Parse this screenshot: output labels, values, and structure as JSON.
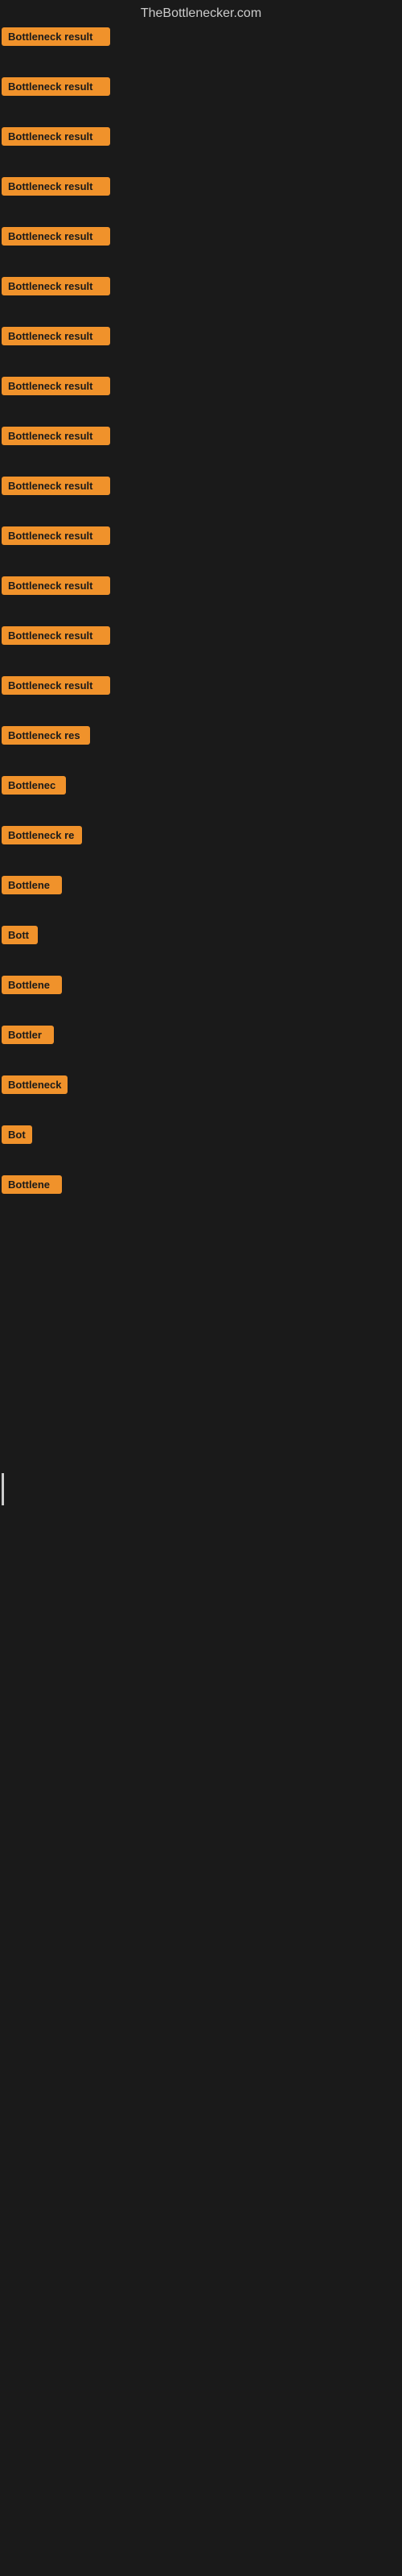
{
  "site": {
    "title": "TheBottlenecker.com"
  },
  "items": [
    {
      "id": 1,
      "label": "Bottleneck result",
      "width": 135
    },
    {
      "id": 2,
      "label": "Bottleneck result",
      "width": 135
    },
    {
      "id": 3,
      "label": "Bottleneck result",
      "width": 135
    },
    {
      "id": 4,
      "label": "Bottleneck result",
      "width": 135
    },
    {
      "id": 5,
      "label": "Bottleneck result",
      "width": 135
    },
    {
      "id": 6,
      "label": "Bottleneck result",
      "width": 135
    },
    {
      "id": 7,
      "label": "Bottleneck result",
      "width": 135
    },
    {
      "id": 8,
      "label": "Bottleneck result",
      "width": 135
    },
    {
      "id": 9,
      "label": "Bottleneck result",
      "width": 135
    },
    {
      "id": 10,
      "label": "Bottleneck result",
      "width": 135
    },
    {
      "id": 11,
      "label": "Bottleneck result",
      "width": 135
    },
    {
      "id": 12,
      "label": "Bottleneck result",
      "width": 135
    },
    {
      "id": 13,
      "label": "Bottleneck result",
      "width": 135
    },
    {
      "id": 14,
      "label": "Bottleneck result",
      "width": 135
    },
    {
      "id": 15,
      "label": "Bottleneck res",
      "width": 110
    },
    {
      "id": 16,
      "label": "Bottlenec",
      "width": 80
    },
    {
      "id": 17,
      "label": "Bottleneck re",
      "width": 100
    },
    {
      "id": 18,
      "label": "Bottlene",
      "width": 75
    },
    {
      "id": 19,
      "label": "Bott",
      "width": 45
    },
    {
      "id": 20,
      "label": "Bottlene",
      "width": 75
    },
    {
      "id": 21,
      "label": "Bottler",
      "width": 65
    },
    {
      "id": 22,
      "label": "Bottleneck",
      "width": 82
    },
    {
      "id": 23,
      "label": "Bot",
      "width": 38
    },
    {
      "id": 24,
      "label": "Bottlene",
      "width": 75
    }
  ],
  "colors": {
    "badge_bg": "#f0922b",
    "badge_text": "#1a1a1a",
    "background": "#1a1a1a",
    "title_text": "#cccccc"
  }
}
